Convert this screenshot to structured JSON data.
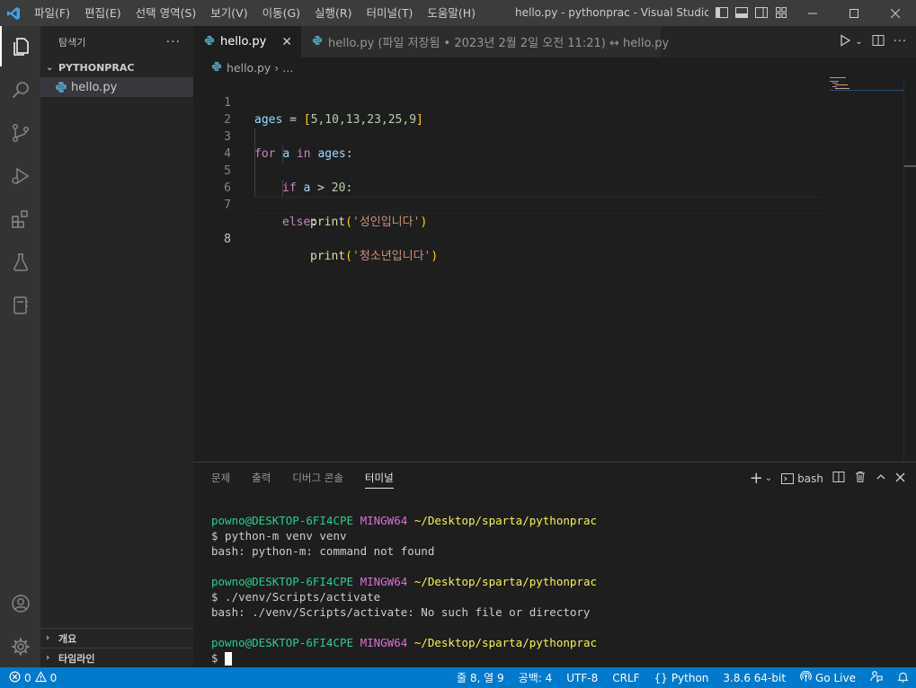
{
  "titlebar": {
    "menu": [
      "파일(F)",
      "편집(E)",
      "선택 영역(S)",
      "보기(V)",
      "이동(G)",
      "실행(R)",
      "터미널(T)",
      "도움말(H)"
    ],
    "title": "hello.py - pythonprac - Visual Studio C..."
  },
  "sidebar": {
    "header": "탐색기",
    "more": "···",
    "folder": "PYTHONPRAC",
    "file": "hello.py",
    "outline": "개요",
    "timeline": "타임라인"
  },
  "tabs": {
    "active": "hello.py",
    "inactive": "hello.py (파일 저장됨 • 2023년 2월 2일 오전 11:21) ↔ hello.py"
  },
  "breadcrumb": {
    "file": "hello.py",
    "more": "..."
  },
  "code": {
    "line_numbers": [
      "1",
      "2",
      "3",
      "4",
      "5",
      "6",
      "7",
      "8"
    ],
    "l1_var": "ages",
    "l1_op": " = ",
    "l1_open": "[",
    "l1_vals": "5,10,13,23,25,9",
    "l1_close": "]",
    "l3_for": "for",
    "l3_a": "a",
    "l3_in": "in",
    "l3_ages": "ages",
    "l3_colon": ":",
    "l4_if": "if",
    "l4_a": "a",
    "l4_gt": " > ",
    "l4_num": "20",
    "l4_colon": ":",
    "l5_print": "print",
    "l5_open": "(",
    "l5_str": "'성인입니다'",
    "l5_close": ")",
    "l6_else": "else",
    "l6_colon": ":",
    "l7_print": "print",
    "l7_open": "(",
    "l7_str": "'청소년입니다'",
    "l7_close": ")"
  },
  "panel": {
    "tabs": [
      "문제",
      "출력",
      "디버그 콘솔",
      "터미널"
    ],
    "shell": "bash"
  },
  "terminal": {
    "user_host": "powno@DESKTOP-6FI4CPE",
    "mingw": "MINGW64",
    "path": "~/Desktop/sparta/pythonprac",
    "cmd1": "$ python-m venv venv",
    "out1": "bash: python-m: command not found",
    "cmd2": "$ ./venv/Scripts/activate",
    "out2": "bash: ./venv/Scripts/activate: No such file or directory",
    "prompt": "$ "
  },
  "statusbar": {
    "errors": "0",
    "warnings": "0",
    "position": "줄 8, 열 9",
    "spaces": "공백: 4",
    "encoding": "UTF-8",
    "eol": "CRLF",
    "language": "Python",
    "interpreter": "3.8.6 64-bit",
    "golive": "Go Live"
  },
  "colors": {
    "statusbar": "#007acc",
    "activitybar": "#333333",
    "sidebar": "#252526",
    "editor": "#1e1e1e"
  }
}
